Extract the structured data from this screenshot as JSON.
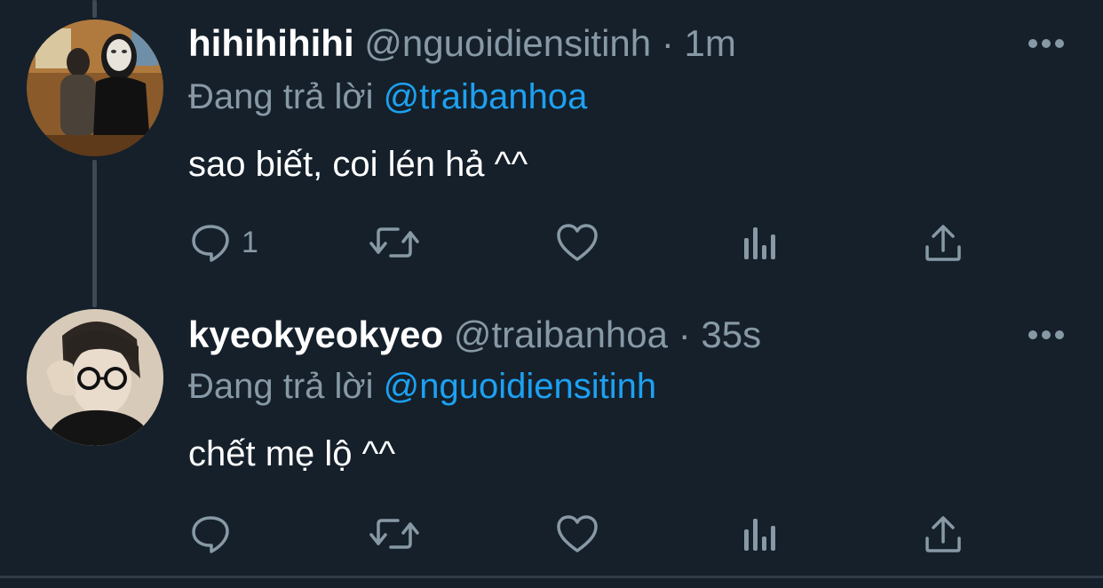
{
  "tweets": [
    {
      "display_name": "hihihihihi",
      "handle": "@nguoidiensitinh",
      "separator": "·",
      "time": "1m",
      "replying_label": "Đang trả lời",
      "replying_to": "@traibanhoa",
      "text": "sao biết, coi lén hả ^^",
      "reply_count": "1",
      "avatar_icon": "person-with-masked-figure-photo"
    },
    {
      "display_name": "kyeokyeokyeo",
      "handle": "@traibanhoa",
      "separator": "·",
      "time": "35s",
      "replying_label": "Đang trả lời",
      "replying_to": "@nguoidiensitinh",
      "text": "chết mẹ lộ ^^",
      "reply_count": "",
      "avatar_icon": "person-with-glasses-photo"
    }
  ],
  "colors": {
    "background": "#15202b",
    "text_primary": "#ffffff",
    "text_secondary": "#8899a6",
    "accent": "#1da1f2",
    "thread_line": "#3d4a56"
  },
  "icons": {
    "reply": "reply-icon",
    "retweet": "retweet-icon",
    "like": "like-icon",
    "views": "analytics-icon",
    "share": "share-icon",
    "more": "more-options-icon"
  }
}
